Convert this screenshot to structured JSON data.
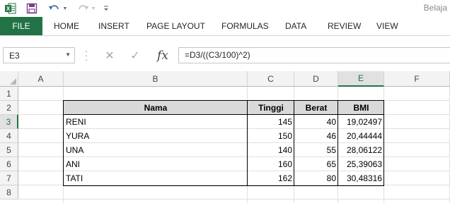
{
  "quick_access": {
    "excel_icon": "excel-icon",
    "save_icon": "save-icon",
    "undo_icon": "undo-icon",
    "redo_icon": "redo-icon",
    "customize_icon": "customize-icon"
  },
  "title": "Belaja",
  "ribbon": {
    "file": "FILE",
    "tabs": [
      "HOME",
      "INSERT",
      "PAGE LAYOUT",
      "FORMULAS",
      "DATA",
      "REVIEW",
      "VIEW"
    ]
  },
  "name_box": "E3",
  "formula_bar": {
    "cancel": "✕",
    "enter": "✓",
    "fx": "fx",
    "formula": "=D3/((C3/100)^2)"
  },
  "grid": {
    "columns": [
      "A",
      "B",
      "C",
      "D",
      "E",
      "F"
    ],
    "rows": [
      "1",
      "2",
      "3",
      "4",
      "5",
      "6",
      "7",
      "8"
    ],
    "selected_cell": "E3"
  },
  "table": {
    "headers": [
      "Nama",
      "Tinggi",
      "Berat",
      "BMI"
    ],
    "rows": [
      [
        "RENI",
        "145",
        "40",
        "19,02497"
      ],
      [
        "YURA",
        "150",
        "46",
        "20,44444"
      ],
      [
        "UNA",
        "140",
        "55",
        "28,06122"
      ],
      [
        "ANI",
        "160",
        "65",
        "25,39063"
      ],
      [
        "TATI",
        "162",
        "80",
        "30,48316"
      ]
    ]
  },
  "colors": {
    "accent": "#217346",
    "header_fill": "#d9d9d9"
  }
}
